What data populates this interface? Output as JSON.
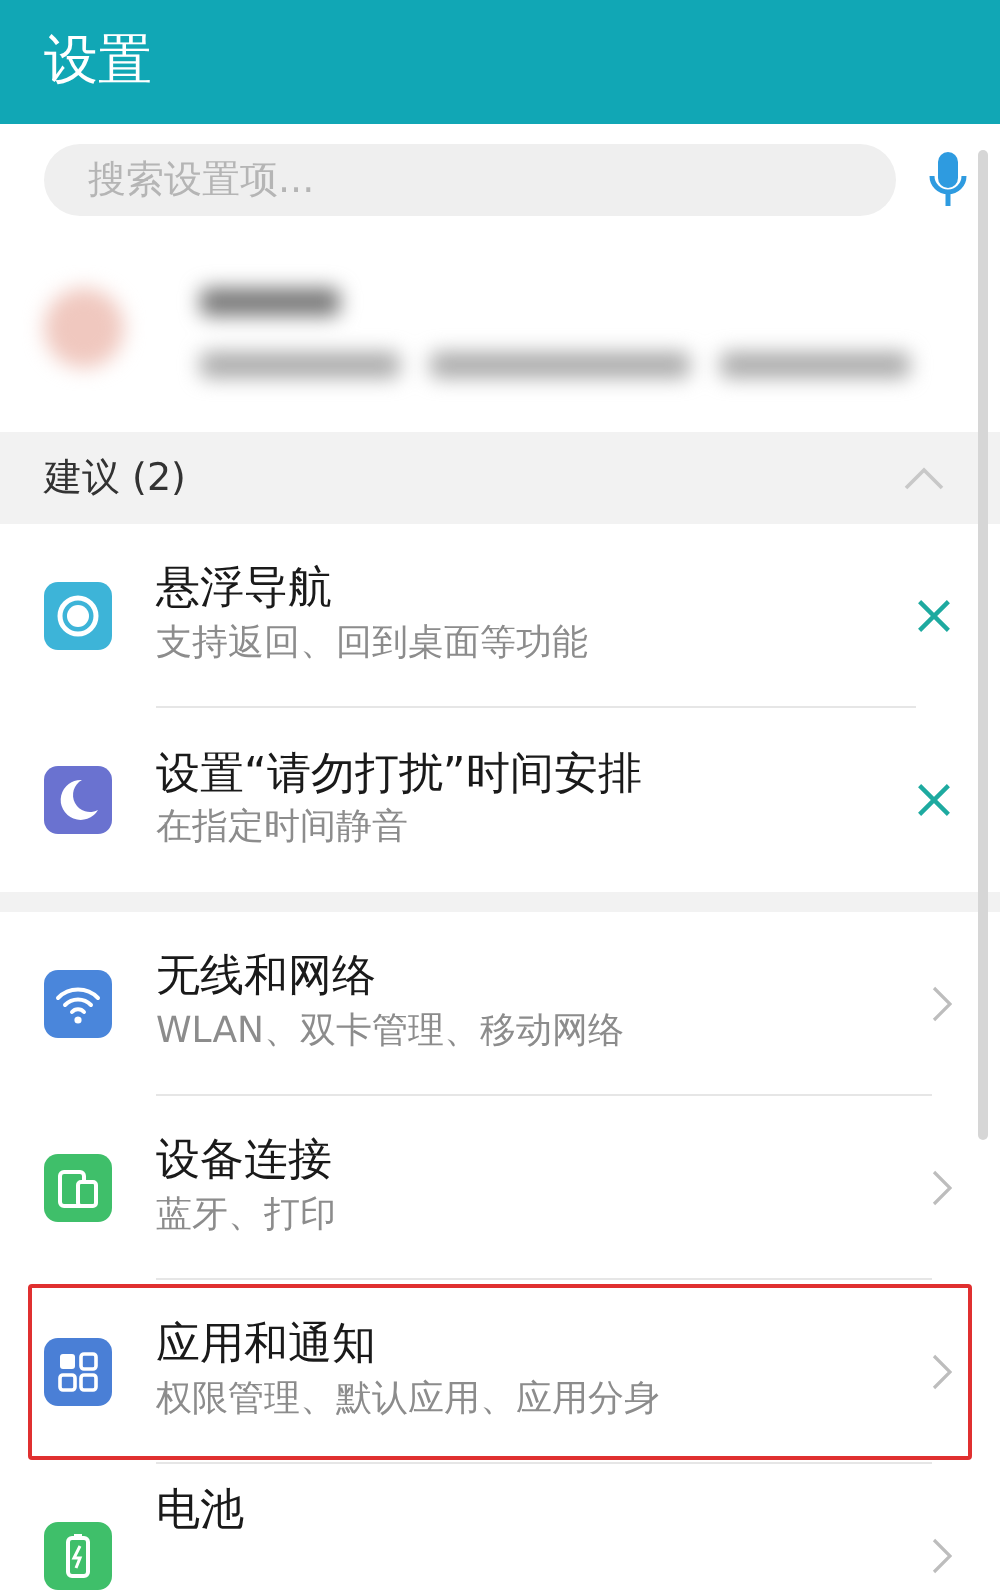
{
  "header": {
    "title": "设置"
  },
  "search": {
    "placeholder": "搜索设置项..."
  },
  "account": {
    "kind": "blurred"
  },
  "suggestions": {
    "title": "建议 (2)",
    "expanded": true,
    "items": [
      {
        "kind": "float-nav",
        "title": "悬浮导航",
        "subtitle": "支持返回、回到桌面等功能"
      },
      {
        "kind": "moon",
        "title": "设置“请勿打扰”时间安排",
        "subtitle": "在指定时间静音"
      }
    ]
  },
  "settings": [
    {
      "kind": "wifi",
      "title": "无线和网络",
      "subtitle": "WLAN、双卡管理、移动网络",
      "highlighted": false
    },
    {
      "kind": "device",
      "title": "设备连接",
      "subtitle": "蓝牙、打印",
      "highlighted": false
    },
    {
      "kind": "apps",
      "title": "应用和通知",
      "subtitle": "权限管理、默认应用、应用分身",
      "highlighted": true
    },
    {
      "kind": "battery",
      "title": "电池",
      "highlighted": false
    }
  ]
}
